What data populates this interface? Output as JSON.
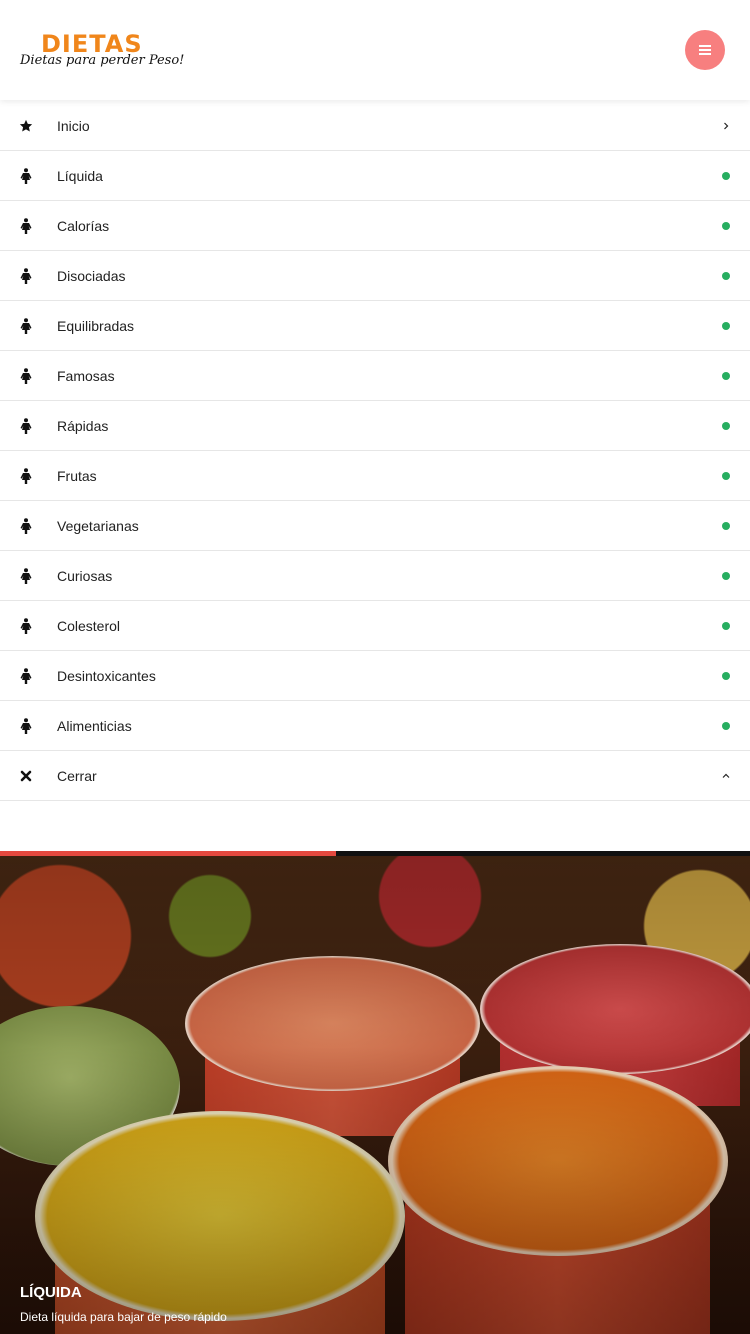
{
  "header": {
    "logo_title": "DIETAS",
    "logo_subtitle": "Dietas para perder Peso!",
    "menu_button_icon": "hamburger-icon",
    "brand_color": "#f0861b",
    "menu_button_color": "#f77f7f"
  },
  "menu": {
    "items": [
      {
        "label": "Inicio",
        "icon": "star-icon",
        "right": "chevron-right-icon"
      },
      {
        "label": "Líquida",
        "icon": "person-icon",
        "right": "green-dot"
      },
      {
        "label": "Calorías",
        "icon": "person-icon",
        "right": "green-dot"
      },
      {
        "label": "Disociadas",
        "icon": "person-icon",
        "right": "green-dot"
      },
      {
        "label": "Equilibradas",
        "icon": "person-icon",
        "right": "green-dot"
      },
      {
        "label": "Famosas",
        "icon": "person-icon",
        "right": "green-dot"
      },
      {
        "label": "Rápidas",
        "icon": "person-icon",
        "right": "green-dot"
      },
      {
        "label": "Frutas",
        "icon": "person-icon",
        "right": "green-dot"
      },
      {
        "label": "Vegetarianas",
        "icon": "person-icon",
        "right": "green-dot"
      },
      {
        "label": "Curiosas",
        "icon": "person-icon",
        "right": "green-dot"
      },
      {
        "label": "Colesterol",
        "icon": "person-icon",
        "right": "green-dot"
      },
      {
        "label": "Desintoxicantes",
        "icon": "person-icon",
        "right": "green-dot"
      },
      {
        "label": "Alimenticias",
        "icon": "person-icon",
        "right": "green-dot"
      },
      {
        "label": "Cerrar",
        "icon": "close-icon",
        "right": "chevron-up-icon"
      }
    ],
    "dot_color": "#27ae60"
  },
  "slider": {
    "progress": 0.448,
    "progress_color": "#e5493f",
    "title": "LÍQUIDA",
    "subtitle": "Dieta líquida para bajar de peso rápido"
  }
}
